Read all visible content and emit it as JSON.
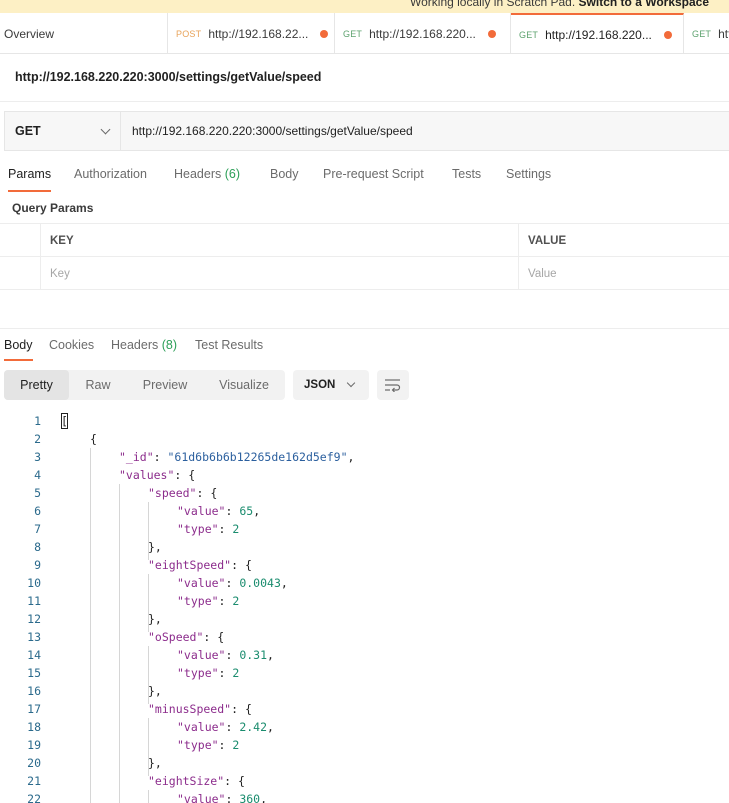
{
  "banner": {
    "text": "Working locally in Scratch Pad.",
    "link": "Switch to a Workspace"
  },
  "tabs": [
    {
      "label": "Overview"
    },
    {
      "method": "POST",
      "url": "http://192.168.22..."
    },
    {
      "method": "GET",
      "url": "http://192.168.220..."
    },
    {
      "method": "GET",
      "url": "http://192.168.220..."
    },
    {
      "method": "GET",
      "url": "htt"
    }
  ],
  "request": {
    "title": "http://192.168.220.220:3000/settings/getValue/speed",
    "method": "GET",
    "url": "http://192.168.220.220:3000/settings/getValue/speed"
  },
  "request_tabs": [
    {
      "label": "Params"
    },
    {
      "label": "Authorization"
    },
    {
      "label": "Headers",
      "count": "(6)"
    },
    {
      "label": "Body"
    },
    {
      "label": "Pre-request Script"
    },
    {
      "label": "Tests"
    },
    {
      "label": "Settings"
    }
  ],
  "query_params": {
    "title": "Query Params",
    "key_header": "KEY",
    "value_header": "VALUE",
    "key_placeholder": "Key",
    "value_placeholder": "Value"
  },
  "response_tabs": [
    {
      "label": "Body"
    },
    {
      "label": "Cookies"
    },
    {
      "label": "Headers",
      "count": "(8)"
    },
    {
      "label": "Test Results"
    }
  ],
  "format_options": [
    {
      "label": "Pretty"
    },
    {
      "label": "Raw"
    },
    {
      "label": "Preview"
    },
    {
      "label": "Visualize"
    }
  ],
  "language": "JSON",
  "icons": {
    "wrap": "wrap-lines-icon",
    "dropdown": "chevron-down-icon"
  },
  "colors": {
    "accent": "#f26b3a",
    "get": "#5ea36f",
    "post": "#e8a35a",
    "count": "#2c9f58"
  },
  "code_lines": [
    {
      "n": "1",
      "t": "["
    },
    {
      "n": "2",
      "t": "{"
    },
    {
      "n": "3",
      "k": "\"_id\"",
      "p": ": ",
      "s": "\"61d6b6b6b12265de162d5ef9\"",
      "e": ","
    },
    {
      "n": "4",
      "k": "\"values\"",
      "p": ": {"
    },
    {
      "n": "5",
      "k": "\"speed\"",
      "p": ": {"
    },
    {
      "n": "6",
      "k": "\"value\"",
      "p": ": ",
      "v": "65",
      "e": ","
    },
    {
      "n": "7",
      "k": "\"type\"",
      "p": ": ",
      "v": "2"
    },
    {
      "n": "8",
      "t": "},"
    },
    {
      "n": "9",
      "k": "\"eightSpeed\"",
      "p": ": {"
    },
    {
      "n": "10",
      "k": "\"value\"",
      "p": ": ",
      "v": "0.0043",
      "e": ","
    },
    {
      "n": "11",
      "k": "\"type\"",
      "p": ": ",
      "v": "2"
    },
    {
      "n": "12",
      "t": "},"
    },
    {
      "n": "13",
      "k": "\"oSpeed\"",
      "p": ": {"
    },
    {
      "n": "14",
      "k": "\"value\"",
      "p": ": ",
      "v": "0.31",
      "e": ","
    },
    {
      "n": "15",
      "k": "\"type\"",
      "p": ": ",
      "v": "2"
    },
    {
      "n": "16",
      "t": "},"
    },
    {
      "n": "17",
      "k": "\"minusSpeed\"",
      "p": ": {"
    },
    {
      "n": "18",
      "k": "\"value\"",
      "p": ": ",
      "v": "2.42",
      "e": ","
    },
    {
      "n": "19",
      "k": "\"type\"",
      "p": ": ",
      "v": "2"
    },
    {
      "n": "20",
      "t": "},"
    },
    {
      "n": "21",
      "k": "\"eightSize\"",
      "p": ": {"
    },
    {
      "n": "22",
      "k": "\"value\"",
      "p": ": ",
      "v": "360",
      "e": ","
    }
  ]
}
